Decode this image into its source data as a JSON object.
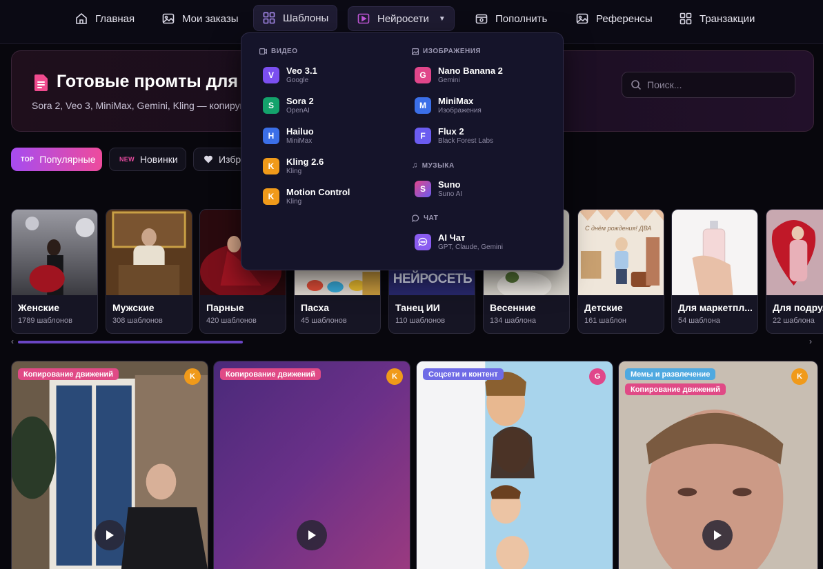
{
  "nav": {
    "items": [
      {
        "label": "Главная",
        "icon": "home-icon"
      },
      {
        "label": "Мои заказы",
        "icon": "image-icon"
      },
      {
        "label": "Шаблоны",
        "icon": "layout-icon"
      },
      {
        "label": "Нейросети",
        "icon": "video-icon"
      },
      {
        "label": "Пополнить",
        "icon": "wallet-icon"
      },
      {
        "label": "Референсы",
        "icon": "image-icon"
      },
      {
        "label": "Транзакции",
        "icon": "grid-icon"
      }
    ]
  },
  "hero": {
    "title": "Готовые промты для нейросетей",
    "subtitle": "Sora 2, Veo 3, MiniMax, Gemini, Kling — копируйте и создавайте контент за секунды"
  },
  "search": {
    "placeholder": "Поиск..."
  },
  "filters": [
    {
      "badge": "TOP",
      "label": "Популярные"
    },
    {
      "badge": "NEW",
      "label": "Новинки"
    },
    {
      "label": "Избранное"
    }
  ],
  "categories": [
    {
      "name": "Женские",
      "count": "1789 шаблонов"
    },
    {
      "name": "Мужские",
      "count": "308 шаблонов"
    },
    {
      "name": "Парные",
      "count": "420 шаблонов"
    },
    {
      "name": "Пасха",
      "count": "45 шаблонов"
    },
    {
      "name": "Танец ИИ",
      "count": "110 шаблонов",
      "image_text": "НЕЙРОСЕТЬ"
    },
    {
      "name": "Весенние",
      "count": "134 шаблона"
    },
    {
      "name": "Детские",
      "count": "161 шаблон",
      "image_text": "С днём рождения! ДВА"
    },
    {
      "name": "Для маркетпл...",
      "count": "54 шаблона"
    },
    {
      "name": "Для подру...",
      "count": "22 шаблона"
    }
  ],
  "video_cards": [
    {
      "tags": [
        "Копирование движений"
      ],
      "model": "K",
      "model_color": "#f09a1a"
    },
    {
      "tags": [
        "Копирование движений"
      ],
      "model": "K",
      "model_color": "#f09a1a"
    },
    {
      "tags": [
        "Соцсети и контент"
      ],
      "model": "G",
      "model_color": "#e0468a"
    },
    {
      "tags": [
        "Мемы и развлечение",
        "Копирование движений"
      ],
      "model": "K",
      "model_color": "#f09a1a"
    }
  ],
  "dropdown": {
    "sections": {
      "video": "ВИДЕО",
      "images": "ИЗОБРАЖЕНИЯ",
      "music": "МУЗЫКА",
      "chat": "ЧАТ"
    },
    "video": [
      {
        "letter": "V",
        "name": "Veo 3.1",
        "provider": "Google",
        "color": "#7b4ff0"
      },
      {
        "letter": "S",
        "name": "Sora 2",
        "provider": "OpenAI",
        "color": "#14a36c"
      },
      {
        "letter": "H",
        "name": "Hailuo",
        "provider": "MiniMax",
        "color": "#3b6fe8"
      },
      {
        "letter": "K",
        "name": "Kling 2.6",
        "provider": "Kling",
        "color": "#f09a1a"
      },
      {
        "letter": "K",
        "name": "Motion Control",
        "provider": "Kling",
        "color": "#f09a1a"
      }
    ],
    "images": [
      {
        "letter": "G",
        "name": "Nano Banana 2",
        "provider": "Gemini",
        "color": "#e0468a"
      },
      {
        "letter": "M",
        "name": "MiniMax",
        "provider": "Изображения",
        "color": "#3b6fe8"
      },
      {
        "letter": "F",
        "name": "Flux 2",
        "provider": "Black Forest Labs",
        "color": "#6b5cf0"
      }
    ],
    "music": [
      {
        "letter": "S",
        "name": "Suno",
        "provider": "Suno AI",
        "color": "#b25ad0"
      }
    ],
    "chat": [
      {
        "letter": "",
        "name": "AI Чат",
        "provider": "GPT, Claude, Gemini",
        "color": "#8a5cf0"
      }
    ]
  }
}
